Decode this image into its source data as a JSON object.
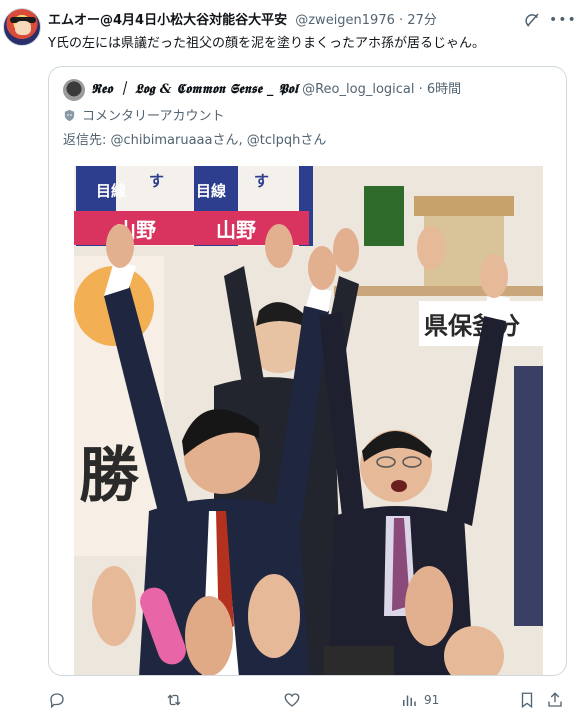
{
  "post": {
    "display_name": "エムオー@4月4日小松大谷対能谷大平安",
    "handle": "@zweigen1976",
    "separator": "·",
    "time": "27分",
    "text": "Y氏の左には県議だった祖父の顔を泥を塗りまくったアホ孫が居るじゃん。",
    "avatar_icon": "user-avatar",
    "grok_icon": "grok-icon",
    "more_icon": "more-icon"
  },
  "quote": {
    "display_name": "𝕽𝖊𝖔 ｜ 𝕷𝖔𝖌 & 𝕮𝖔𝖒𝖒𝖔𝖓 𝕾𝖊𝖓𝖘𝖊 _ 𝕻𝖔𝖑",
    "handle": "@Reo_log_logical",
    "separator": "·",
    "time": "6時間",
    "label": "コメンタリーアカウント",
    "reply_prefix": "返信先: ",
    "reply_mention_1": "@chibimaruaaa",
    "reply_mid": "さん, ",
    "reply_mention_2": "@tclpqh",
    "reply_suffix": "さん",
    "photo_signs": {
      "poster_left_name": "山野",
      "poster_right_name": "山野",
      "poster_left_tag": "目線",
      "poster_right_tag": "目線",
      "poster_left_sub": "す",
      "poster_right_sub": "す",
      "banner_right": "県保釜分",
      "banner_left": "勝"
    }
  },
  "actions": {
    "reply_icon": "reply-icon",
    "retweet_icon": "retweet-icon",
    "like_icon": "like-icon",
    "views_icon": "views-icon",
    "views_count": "91",
    "bookmark_icon": "bookmark-icon",
    "share_icon": "share-icon"
  },
  "colors": {
    "text_primary": "#0f1419",
    "text_secondary": "#536471",
    "border": "#cfd9de"
  }
}
